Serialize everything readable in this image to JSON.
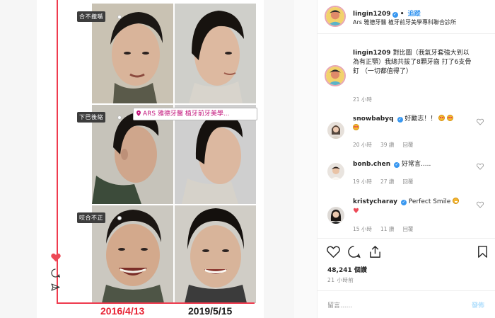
{
  "media": {
    "labels": {
      "top": "合不攏嘴",
      "middle": "下巴後縮",
      "bottom": "咬合不正"
    },
    "location_tag": "ARS 雅德牙醫 植牙前牙美學...",
    "date_before": "2016/4/13",
    "date_after": "2019/5/15",
    "accent_color": "#ef3b4e",
    "icons": [
      "heart-icon",
      "comment-icon",
      "share-icon",
      "chevron-right-icon"
    ]
  },
  "header": {
    "username": "lingin1209",
    "follow_label": "追蹤",
    "location": "Ars 雅德牙醫 植牙前牙美學專科聯合診所"
  },
  "caption": {
    "username": "lingin1209",
    "text": "對比圖（我氣牙套強大到以為有正顎）我總共拔了8顆牙齒 打了6支骨釘 （一切都值得了）",
    "time": "21 小時"
  },
  "comments": [
    {
      "username": "snowbabyq",
      "text": "好勵志！！",
      "time": "20 小時",
      "likes": "39 讚",
      "reply": "回覆"
    },
    {
      "username": "bonb.chen",
      "text": "好常言.....",
      "time": "19 小時",
      "likes": "27 讚",
      "reply": "回覆"
    },
    {
      "username": "kristycharay",
      "text": "Perfect Smile",
      "time": "15 小時",
      "likes": "11 讚",
      "reply": "回覆"
    }
  ],
  "footer": {
    "likes": "48,241 個讚",
    "posted": "21 小時前",
    "comment_placeholder": "留言......",
    "post_label": "發佈"
  },
  "colors": {
    "brand_blue": "#3897f0",
    "heart_red": "#ed4956"
  }
}
